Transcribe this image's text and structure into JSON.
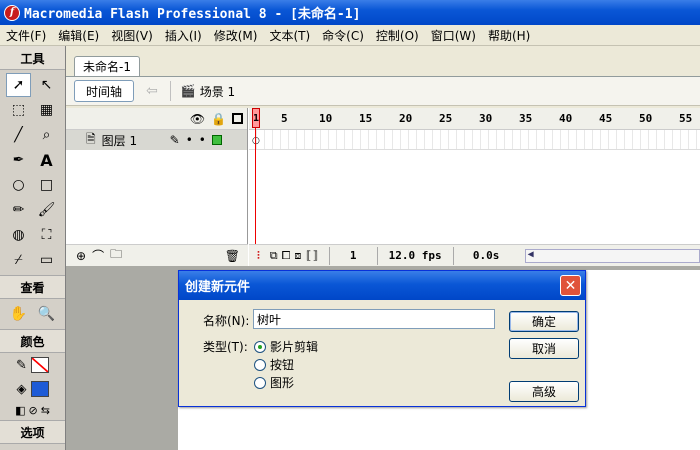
{
  "window": {
    "title": "Macromedia Flash Professional 8 - [未命名-1]",
    "app_icon_letter": "f"
  },
  "menu": [
    "文件(F)",
    "编辑(E)",
    "视图(V)",
    "插入(I)",
    "修改(M)",
    "文本(T)",
    "命令(C)",
    "控制(O)",
    "窗口(W)",
    "帮助(H)"
  ],
  "tools": {
    "header": "工具",
    "view_header": "查看",
    "colors_header": "颜色",
    "options_header": "选项",
    "icons": [
      "selection-arrow-icon",
      "subselection-arrow-icon",
      "free-transform-icon",
      "gradient-transform-icon",
      "line-icon",
      "lasso-icon",
      "pen-icon",
      "text-icon",
      "oval-icon",
      "rectangle-icon",
      "pencil-icon",
      "brush-icon",
      "ink-bottle-icon",
      "paint-bucket-icon",
      "eyedropper-icon",
      "eraser-icon"
    ],
    "glyphs": [
      "➚",
      "↖",
      "⬚",
      "▦",
      "╱",
      "⌕",
      "✒",
      "A",
      "○",
      "□",
      "✏",
      "🖌",
      "◍",
      "⛶",
      "⌿",
      "▭"
    ],
    "view_glyphs": [
      "✋",
      "🔍"
    ],
    "fill_color": "#1e5bd6",
    "stroke_color": "#ff0000"
  },
  "document": {
    "tab_label": "未命名-1",
    "timeline_button": "时间轴",
    "scene_label": "场景 1"
  },
  "timeline": {
    "layer_name": "图层 1",
    "ruler_numbers": [
      "1",
      "5",
      "10",
      "15",
      "20",
      "25",
      "30",
      "35",
      "40",
      "45",
      "50",
      "55"
    ],
    "current_frame": "1",
    "fps": "12.0 fps",
    "elapsed": "0.0s"
  },
  "dialog": {
    "title": "创建新元件",
    "name_label": "名称(N):",
    "name_value": "树叶",
    "type_label": "类型(T):",
    "types": [
      "影片剪辑",
      "按钮",
      "图形"
    ],
    "selected_type": 0,
    "ok_label": "确定",
    "cancel_label": "取消",
    "advanced_label": "高级"
  }
}
